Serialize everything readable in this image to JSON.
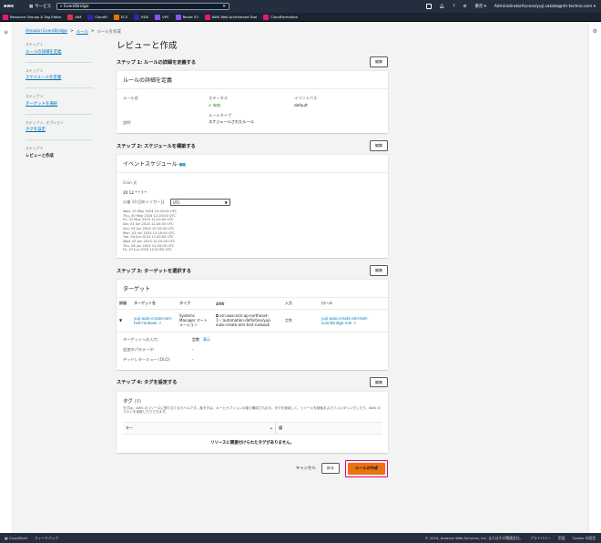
{
  "topbar": {
    "logo": "aws",
    "services_label": "サービス",
    "search_value": "EventBridge",
    "region": "東京 ▾",
    "account": "AdministratorAccess/yuji.sakata@nh-techno.com ▾"
  },
  "favorites": [
    {
      "label": "Resource Groups & Tag Editor",
      "color": "#e7157b"
    },
    {
      "label": "IAM",
      "color": "#dd344c"
    },
    {
      "label": "Cloud9",
      "color": "#2e27ad"
    },
    {
      "label": "EC2",
      "color": "#ed7100"
    },
    {
      "label": "RDS",
      "color": "#2e27ad"
    },
    {
      "label": "VPC",
      "color": "#8c4fff"
    },
    {
      "label": "Route 53",
      "color": "#8c4fff"
    },
    {
      "label": "AWS Well-Architected Tool",
      "color": "#e7157b"
    },
    {
      "label": "CloudFormation",
      "color": "#e7157b"
    }
  ],
  "breadcrumb": {
    "root": "Amazon EventBridge",
    "sep": ">",
    "rules": "ルール",
    "current": "ルールを作成"
  },
  "steps": [
    {
      "num": "ステップ 1",
      "label": "ルールの詳細を定義"
    },
    {
      "num": "ステップ 2",
      "label": "スケジュールを定義"
    },
    {
      "num": "ステップ 3",
      "label": "ターゲットを選択"
    },
    {
      "num": "ステップ 4 - オプション",
      "label": "タグを設定"
    },
    {
      "num": "ステップ 5",
      "label": "レビューと作成"
    }
  ],
  "page_title": "レビューと作成",
  "edit_label": "編集",
  "step1": {
    "title": "ステップ 1: ルールの詳細を定義する",
    "panel_title": "ルールの詳細を定義",
    "name_label": "ルール名",
    "status_label": "ステータス",
    "status_value": "有効",
    "bus_label": "イベントバス",
    "bus_value": "default",
    "desc_label": "説明",
    "type_label": "ルールタイプ",
    "type_value": "スケジュールされたルール"
  },
  "step2": {
    "title": "ステップ 2: スケジュールを構築する",
    "panel_title": "イベントスケジュール",
    "info": "情報",
    "cron_label": "Cron 式",
    "cron_value": "20 12 * * ? *",
    "next_label": "以後 10 回のトリガー日",
    "tz_value": "UTC",
    "dates": [
      "Wed, 29 May 2024 12:20:00 UTC",
      "Thu, 30 May 2024 12:20:00 UTC",
      "Fri, 31 May 2024 12:20:00 UTC",
      "Sat, 01 Jun 2024 12:20:00 UTC",
      "Sun, 02 Jun 2024 12:20:00 UTC",
      "Mon, 03 Jun 2024 12:20:00 UTC",
      "Tue, 04 Jun 2024 12:20:00 UTC",
      "Wed, 05 Jun 2024 12:20:00 UTC",
      "Thu, 06 Jun 2024 12:20:00 UTC",
      "Fri, 07 Jun 2024 12:20:00 UTC"
    ]
  },
  "step3": {
    "title": "ステップ 3: ターゲットを選択する",
    "panel_title": "ターゲット",
    "cols": [
      "詳細",
      "ターゲット名",
      "タイプ",
      "ARN",
      "入力",
      "ロール"
    ],
    "row": {
      "name": "yuji-auto-create-ami-test-runbook",
      "type": "Systems Manager オートメーション",
      "arn": "arn:aws:ssm:ap-northeast-1:··:automation-definition/yuji-auto-create-ami-test-runbook",
      "input": "定数",
      "role": "yuji-auto-create-ami-test-eventbridge-role"
    },
    "input_label": "ターゲットへの入力:",
    "input_value": "定数",
    "input_show": "表示",
    "params_label": "追加のパラメータ:",
    "params_value": "-",
    "dlq_label": "デッドレターキュー (DLQ):",
    "dlq_value": "-"
  },
  "step4": {
    "title": "ステップ 4: タグを設定する",
    "panel_title": "タグ",
    "count": "(0)",
    "desc": "タグは、AWS のリソースに割り当てるラベルです。各タグは、キーとオプションの値で構成されます。タグを使用して、リソースを検索およびフィルタリングしたり、AWS のコストを追跡したりできます。",
    "key_col": "キー",
    "value_col": "値",
    "empty": "リソースに関連付けられたタグがありません。"
  },
  "actions": {
    "cancel": "キャンセル",
    "back": "戻る",
    "create": "ルールの作成"
  },
  "footer": {
    "cloudshell": "CloudShell",
    "feedback": "フィードバック",
    "copyright": "© 2024, Amazon Web Services, Inc. またはその関連会社。",
    "privacy": "プライバシー",
    "terms": "用語",
    "cookie": "Cookie の設定"
  },
  "colors": {
    "primary": "#ec7211",
    "link": "#0073bb",
    "highlight": "#e6007a",
    "success": "#1d8102"
  }
}
